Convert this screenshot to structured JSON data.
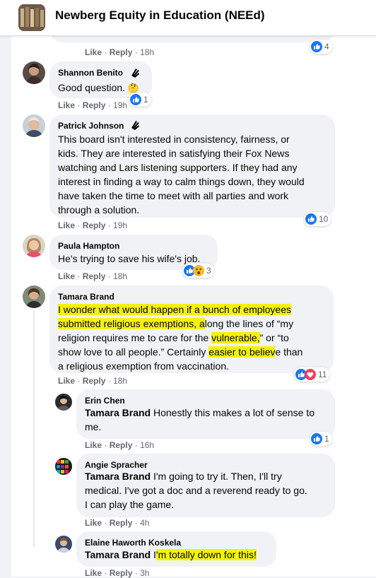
{
  "group": {
    "name": "Newberg Equity in Education (NEEd)"
  },
  "actions": {
    "like": "Like",
    "reply": "Reply",
    "sep": "·"
  },
  "comments": [
    {
      "reaction_count": "4",
      "time": "18h"
    },
    {
      "author": "Shannon Benito",
      "text": "Good question.",
      "emoji": "🤔",
      "reaction_count": "1",
      "time": "19h"
    },
    {
      "author": "Patrick Johnson",
      "lines": [
        "This board isn't interested in consistency, fairness, or",
        "kids. They are interested in satisfying their Fox News",
        "watching and Lars listening supporters. If they had any",
        "interest in finding a way to calm things down, they would",
        "have taken the time to meet with all parties and work",
        "through a solution."
      ],
      "reaction_count": "10",
      "time": "19h"
    },
    {
      "author": "Paula Hampton",
      "text": "He's trying to save his wife's job.",
      "reaction_count": "3",
      "time": "18h"
    },
    {
      "author": "Tamara Brand",
      "l1": "I wonder what would happen if a bunch of employees",
      "l2a": "submitted religious exemptions, a",
      "l2b": "long the lines of “my",
      "l3a": "religion requires me to care for the ",
      "l3b": "vulnerable,",
      "l3c": "” or “to",
      "l4a": "show love to all people.” Certainly ",
      "l4b": "easier to believ",
      "l4c": "e than",
      "l5": "a religious exemption from vaccination.",
      "reaction_count": "11",
      "time": "18h"
    }
  ],
  "replies": [
    {
      "author": "Erin Chen",
      "tag": "Tamara Brand",
      "text1": " Honestly this makes a lot of sense to",
      "text2": "me.",
      "reaction_count": "1",
      "time": "16h"
    },
    {
      "author": "Angie Spracher",
      "tag": "Tamara Brand",
      "text1": " I'm going to try it. Then, I'll try",
      "text2": "medical. I've got a doc and a reverend ready to go.",
      "text3": "I can play the game.",
      "time": "4h"
    },
    {
      "author": "Elaine Haworth Koskela",
      "tag": "Tamara Brand",
      "text_plain": " I",
      "text_hl": "'m totally down for this!",
      "time": "3h"
    }
  ],
  "colors": {
    "like_blue": "#1877f2",
    "highlight": "#f5f20a",
    "love_red": "#f33e58"
  }
}
